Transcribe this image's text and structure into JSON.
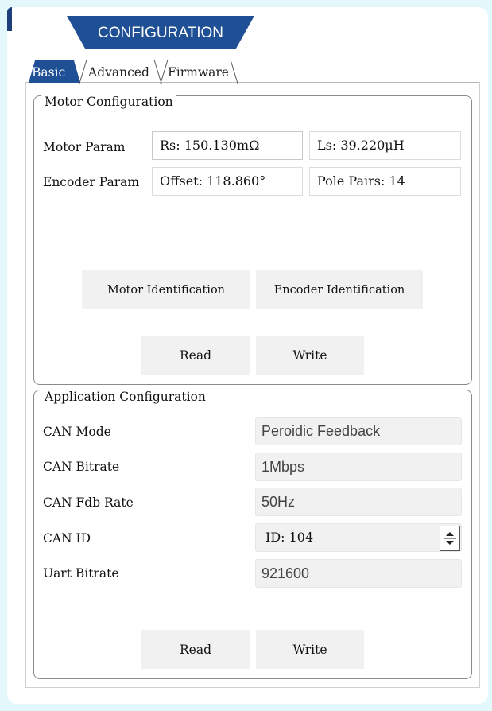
{
  "header": {
    "title": "CONFIGURATION"
  },
  "tabs": [
    {
      "label": "Basic",
      "active": true
    },
    {
      "label": "Advanced",
      "active": false
    },
    {
      "label": "Firmware",
      "active": false
    }
  ],
  "motor_config": {
    "title": "Motor Configuration",
    "motor_param_label": "Motor Param",
    "rs_value": "Rs: 150.130mΩ",
    "ls_value": "Ls: 39.220μH",
    "encoder_param_label": "Encoder Param",
    "offset_value": "Offset: 118.860°",
    "pole_pairs_value": "Pole Pairs: 14",
    "motor_identification_label": "Motor Identification",
    "encoder_identification_label": "Encoder Identification",
    "read_label": "Read",
    "write_label": "Write"
  },
  "app_config": {
    "title": "Application Configuration",
    "can_mode_label": "CAN Mode",
    "can_mode_value": "Peroidic Feedback",
    "can_bitrate_label": "CAN Bitrate",
    "can_bitrate_value": "1Mbps",
    "can_fdb_rate_label": "CAN Fdb Rate",
    "can_fdb_rate_value": "50Hz",
    "can_id_label": "CAN ID",
    "can_id_value": "ID: 104",
    "uart_bitrate_label": "Uart Bitrate",
    "uart_bitrate_value": "921600",
    "read_label": "Read",
    "write_label": "Write"
  },
  "colors": {
    "accent": "#1f4f95",
    "background": "#e3f8fb",
    "button": "#f1f1f1"
  }
}
